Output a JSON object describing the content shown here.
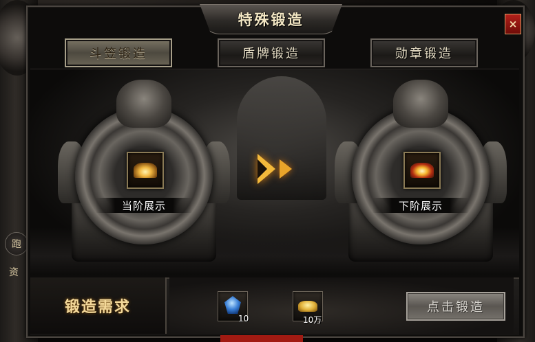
{
  "window": {
    "title": "特殊锻造",
    "close_label": "×"
  },
  "tabs": [
    {
      "label": "斗笠锻造",
      "active": true
    },
    {
      "label": "盾牌锻造",
      "active": false
    },
    {
      "label": "勋章锻造",
      "active": false
    }
  ],
  "stage": {
    "current_label": "当阶展示",
    "next_label": "下阶展示"
  },
  "requirements": {
    "title": "锻造需求",
    "materials": [
      {
        "icon": "blue-gem-icon",
        "count": "10"
      },
      {
        "icon": "gold-ingot-icon",
        "count": "10万"
      }
    ]
  },
  "action": {
    "forge_label": "点击锻造"
  },
  "side": {
    "button_label": "跑",
    "text": "资"
  },
  "colors": {
    "accent_gold": "#f3b93b",
    "close_red": "#b2201a",
    "title_text": "#f3e7c4"
  }
}
